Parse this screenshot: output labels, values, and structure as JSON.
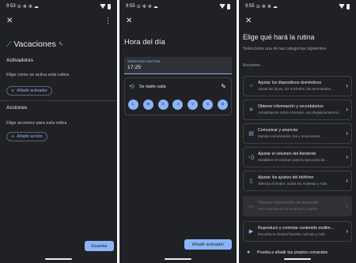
{
  "colors": {
    "background": "#202124",
    "accent": "#8ab4f8",
    "text": "#e8eaed",
    "muted": "#9aa0a6",
    "divider": "#3c4043"
  },
  "panel1": {
    "status_time": "9:53",
    "title": "Vacaciones",
    "title_icon": "pencil-icon",
    "activators_heading": "Activadores",
    "activators_hint": "Elige cómo se activa esta rutina",
    "add_activator": "Añadir activador",
    "actions_heading": "Acciones",
    "actions_hint": "Elige acciones para esta rutina",
    "add_action": "Añadir acción",
    "save": "Guardar"
  },
  "panel2": {
    "status_time": "9:55",
    "title": "Hora del día",
    "time_label": "Selecciona una hora",
    "time_value": "17:25",
    "repeat_label": "Se repite cada",
    "days": [
      "L",
      "M",
      "X",
      "J",
      "V",
      "S",
      "D"
    ],
    "add_activator": "Añadir activador"
  },
  "panel3": {
    "status_time": "9:55",
    "title": "Elige qué hará la rutina",
    "subtitle": "Selecciona una de las categorías siguientes",
    "section": "Acciones",
    "items": [
      {
        "title": "Ajustar los dispositivos domésticos",
        "desc": "Ajusta las luces, los enchufes, los termostatos...",
        "icon": "home-icon"
      },
      {
        "title": "Obtener información y recordatorios",
        "desc": "Actualización sobre el tiempo, tus desplazamientos...",
        "icon": "info-icon"
      },
      {
        "title": "Comunicar y anunciar",
        "desc": "Manda comunicados, lee y envía textos",
        "icon": "chat-icon"
      },
      {
        "title": "Ajustar el volumen del Asistente",
        "desc": "Establece el volumen para la ejecución de...",
        "icon": "volume-icon"
      },
      {
        "title": "Ajustar los ajustes del teléfono",
        "desc": "Silencia el timbre, activa No molestar y más",
        "icon": "phone-icon"
      },
      {
        "title": "Obtener información de bienestar",
        "desc": "Tus estadísticas de actividad y sueño",
        "icon": "wellbeing-icon"
      },
      {
        "title": "Reproducir y controlar contenido multim...",
        "desc": "Escucha tu música favorita, noticias y más",
        "icon": "play-icon"
      }
    ],
    "partial_item": "Prueba a añadir tus propios comandos"
  }
}
